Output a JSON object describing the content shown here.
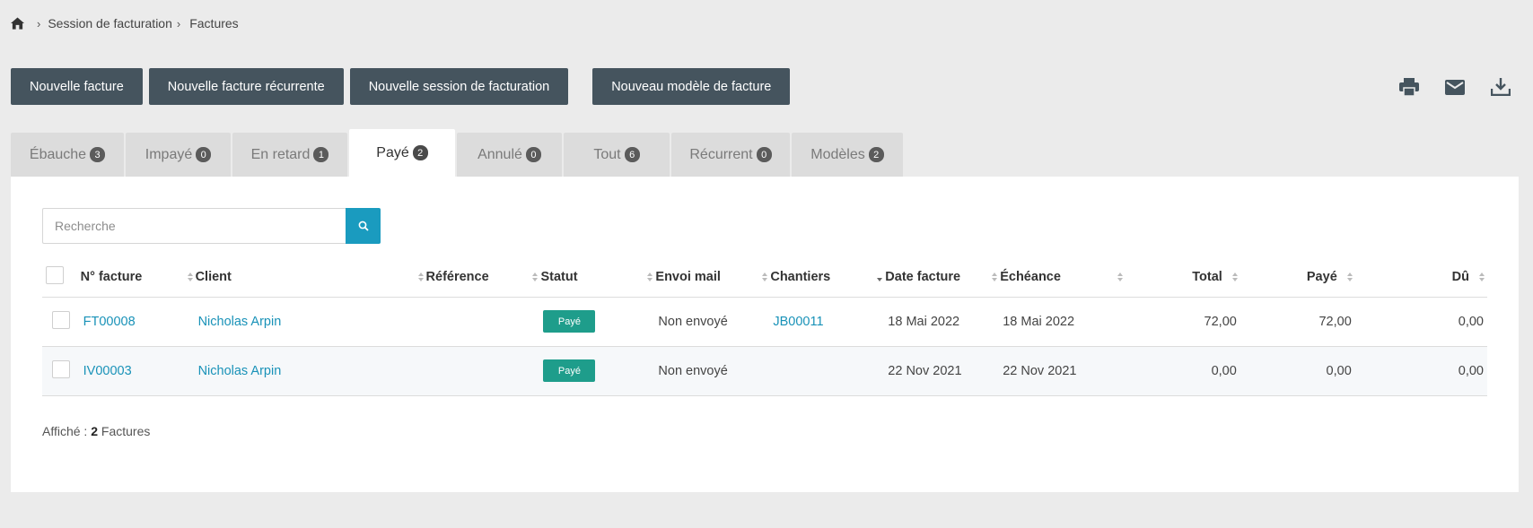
{
  "breadcrumb": {
    "home_icon": "home-icon",
    "items": [
      "Session de facturation",
      "Factures"
    ]
  },
  "actions": {
    "new_invoice": "Nouvelle facture",
    "new_recurring": "Nouvelle facture récurrente",
    "new_session": "Nouvelle session de facturation",
    "new_template": "Nouveau modèle de facture"
  },
  "tools": [
    "print-icon",
    "mail-icon",
    "download-icon"
  ],
  "tabs": [
    {
      "label": "Ébauche",
      "count": "3"
    },
    {
      "label": "Impayé",
      "count": "0"
    },
    {
      "label": "En retard",
      "count": "1"
    },
    {
      "label": "Payé",
      "count": "2",
      "active": true
    },
    {
      "label": "Annulé",
      "count": "0"
    },
    {
      "label": "Tout",
      "count": "6"
    },
    {
      "label": "Récurrent",
      "count": "0"
    },
    {
      "label": "Modèles",
      "count": "2"
    }
  ],
  "search": {
    "placeholder": "Recherche"
  },
  "table": {
    "columns": [
      "N° facture",
      "Client",
      "Référence",
      "Statut",
      "Envoi mail",
      "Chantiers",
      "Date facture",
      "Échéance",
      "Total",
      "Payé",
      "Dû"
    ],
    "rows": [
      {
        "number": "FT00008",
        "client": "Nicholas Arpin",
        "reference": "",
        "status": "Payé",
        "mail": "Non envoyé",
        "site": "JB00011",
        "date": "18 Mai 2022",
        "due_date": "18 Mai 2022",
        "total": "72,00",
        "paid": "72,00",
        "due": "0,00"
      },
      {
        "number": "IV00003",
        "client": "Nicholas Arpin",
        "reference": "",
        "status": "Payé",
        "mail": "Non envoyé",
        "site": "",
        "date": "22 Nov 2021",
        "due_date": "22 Nov 2021",
        "total": "0,00",
        "paid": "0,00",
        "due": "0,00"
      }
    ]
  },
  "footer": {
    "prefix": "Affiché :",
    "count": "2",
    "suffix": "Factures"
  },
  "colors": {
    "button": "#45545e",
    "accent": "#1a9bbf",
    "link": "#1992b8",
    "status_paid": "#1e9d8b"
  }
}
